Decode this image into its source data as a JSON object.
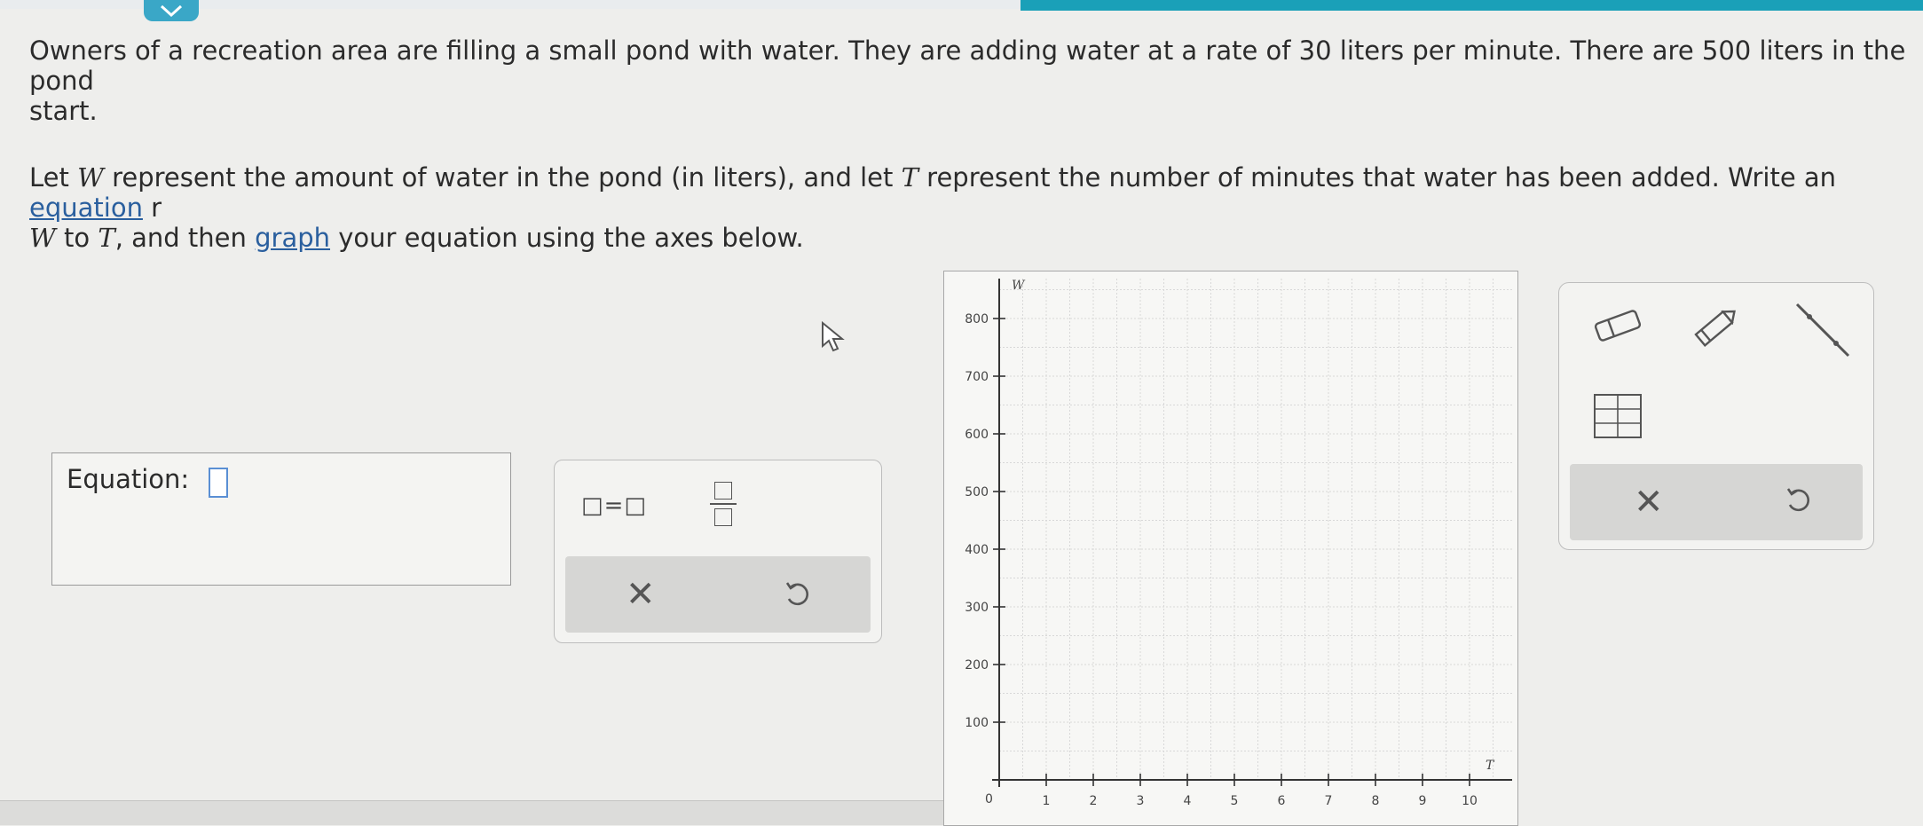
{
  "problem": {
    "p1": "Owners of a recreation area are filling a small pond with water. They are adding water at a rate of 30 liters per minute. There are 500 liters in the pond",
    "p1b": "start.",
    "p2_let": "Let ",
    "var_w": "W",
    "p2_a": " represent the amount of water in the pond (in liters), and let ",
    "var_t": "T",
    "p2_b": " represent the number of minutes that water has been added. Write an ",
    "link_equation": "equation",
    "p2_c": " r",
    "p3_to": " to ",
    "p3_comma": ", and then ",
    "link_graph": "graph",
    "p3_end": " your equation using the axes below."
  },
  "equation": {
    "label": "Equation:"
  },
  "palette": {
    "equals_template": "□=□",
    "clear_symbol": "✕"
  },
  "graph": {
    "y_axis_label": "W",
    "x_axis_label": "T",
    "origin_label": "0",
    "y_ticks": [
      "100",
      "200",
      "300",
      "400",
      "500",
      "600",
      "700",
      "800"
    ],
    "x_ticks": [
      "1",
      "2",
      "3",
      "4",
      "5",
      "6",
      "7",
      "8",
      "9",
      "10"
    ]
  },
  "tools": {
    "clear_symbol": "✕"
  },
  "colors": {
    "accent": "#1aa0b8",
    "link": "#2a5f9e",
    "cursor": "#5a8fd4"
  }
}
